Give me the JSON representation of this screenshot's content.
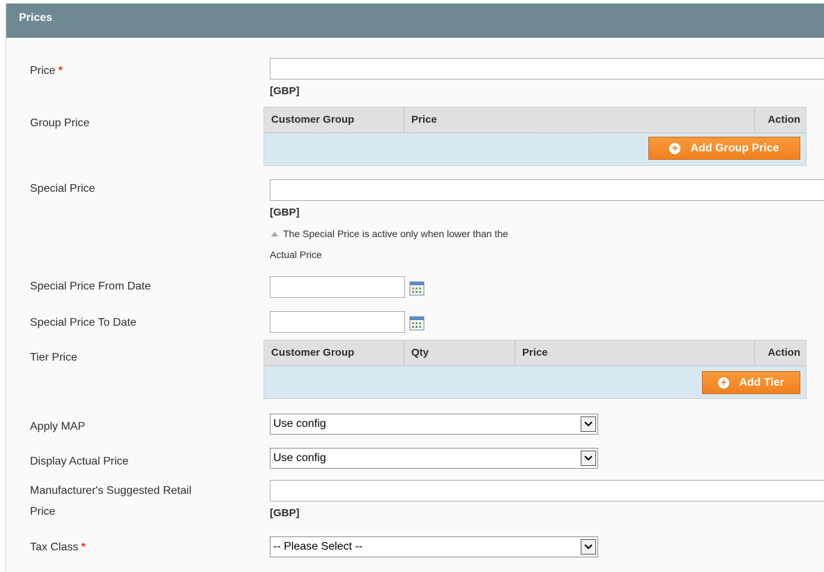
{
  "panel": {
    "title": "Prices"
  },
  "fields": {
    "price": {
      "label": "Price",
      "required_mark": "*",
      "value": "",
      "unit": "[GBP]"
    },
    "group_price": {
      "label": "Group Price",
      "columns": [
        "Customer Group",
        "Price",
        "Action"
      ],
      "add_button": "Add Group Price"
    },
    "special_price": {
      "label": "Special Price",
      "value": "",
      "unit": "[GBP]",
      "note_line1": "The Special Price is active only when lower than the",
      "note_line2": "Actual Price"
    },
    "special_from": {
      "label": "Special Price From Date",
      "value": ""
    },
    "special_to": {
      "label": "Special Price To Date",
      "value": ""
    },
    "tier_price": {
      "label": "Tier Price",
      "columns": [
        "Customer Group",
        "Qty",
        "Price",
        "Action"
      ],
      "add_button": "Add Tier"
    },
    "apply_map": {
      "label": "Apply MAP",
      "selected": "Use config"
    },
    "display_actual": {
      "label": "Display Actual Price",
      "selected": "Use config"
    },
    "msrp": {
      "label_line1": "Manufacturer's Suggested Retail",
      "label_line2": "Price",
      "value": "",
      "unit": "[GBP]"
    },
    "tax_class": {
      "label": "Tax Class",
      "required_mark": "*",
      "selected": "-- Please Select --"
    }
  },
  "icons": {
    "calendar": "calendar-icon",
    "add": "plus-circle-icon",
    "dropdown": "chevron-down-icon",
    "note": "triangle-up-icon"
  },
  "colors": {
    "header_bg": "#6f8992",
    "button_orange": "#f1801e",
    "required_red": "#eb340a",
    "grid_body": "#d9e7f0"
  }
}
